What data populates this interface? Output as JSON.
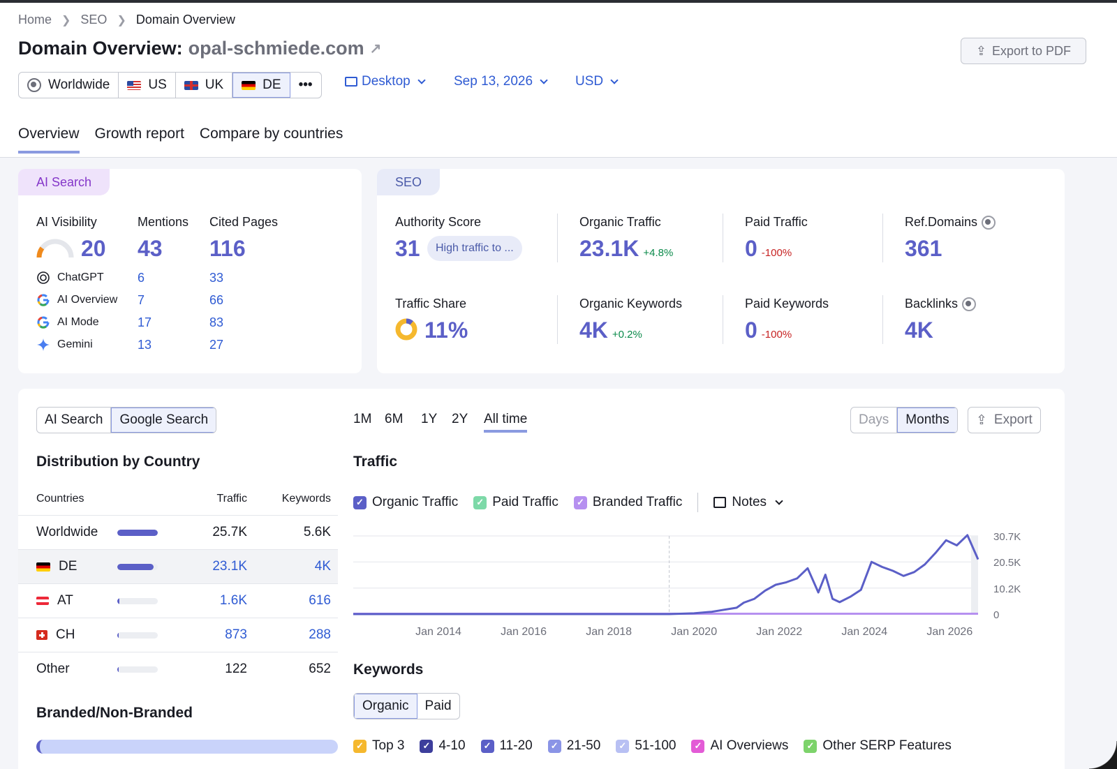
{
  "breadcrumb": [
    "Home",
    "SEO",
    "Domain Overview"
  ],
  "title": {
    "prefix": "Domain Overview:",
    "domain": "opal-schmiede.com"
  },
  "export_pdf_label": "Export to PDF",
  "regions": [
    {
      "label": "Worldwide",
      "flag": "globe-icon"
    },
    {
      "label": "US",
      "flag": "us"
    },
    {
      "label": "UK",
      "flag": "uk"
    },
    {
      "label": "DE",
      "flag": "de",
      "active": true
    }
  ],
  "more_label": "•••",
  "filters": {
    "device": "Desktop",
    "date": "Sep 13, 2026",
    "currency": "USD"
  },
  "tabs": [
    "Overview",
    "Growth report",
    "Compare by countries"
  ],
  "ai_search": {
    "tag": "AI Search",
    "visibility_label": "AI Visibility",
    "visibility_value": "20",
    "visibility_fraction": 0.2,
    "mentions_label": "Mentions",
    "mentions_value": "43",
    "cited_label": "Cited Pages",
    "cited_value": "116",
    "rows": [
      {
        "name": "ChatGPT",
        "mentions": "6",
        "cited": "33",
        "icon": "chatgpt-icon"
      },
      {
        "name": "AI Overview",
        "mentions": "7",
        "cited": "66",
        "icon": "google-icon"
      },
      {
        "name": "AI Mode",
        "mentions": "17",
        "cited": "83",
        "icon": "google-icon"
      },
      {
        "name": "Gemini",
        "mentions": "13",
        "cited": "27",
        "icon": "gemini-icon"
      }
    ]
  },
  "seo": {
    "tag": "SEO",
    "authority_label": "Authority Score",
    "authority_value": "31",
    "authority_pill": "High traffic to ...",
    "organic_traffic_label": "Organic Traffic",
    "organic_traffic_value": "23.1K",
    "organic_traffic_delta": "+4.8%",
    "paid_traffic_label": "Paid Traffic",
    "paid_traffic_value": "0",
    "paid_traffic_delta": "-100%",
    "ref_domains_label": "Ref.Domains",
    "ref_domains_value": "361",
    "traffic_share_label": "Traffic Share",
    "traffic_share_value": "11%",
    "traffic_share_fraction": 0.11,
    "organic_kw_label": "Organic Keywords",
    "organic_kw_value": "4K",
    "organic_kw_delta": "+0.2%",
    "paid_kw_label": "Paid Keywords",
    "paid_kw_value": "0",
    "paid_kw_delta": "-100%",
    "backlinks_label": "Backlinks",
    "backlinks_value": "4K"
  },
  "source_toggle": {
    "options": [
      "AI Search",
      "Google Search"
    ],
    "selected": "Google Search"
  },
  "periods": [
    "1M",
    "6M",
    "1Y",
    "2Y",
    "All time"
  ],
  "period_selected": "All time",
  "granularity": {
    "options": [
      "Days",
      "Months"
    ],
    "selected": "Months"
  },
  "export_label": "Export",
  "distribution": {
    "title": "Distribution by Country",
    "headers": {
      "countries": "Countries",
      "traffic": "Traffic",
      "keywords": "Keywords"
    },
    "rows": [
      {
        "country": "Worldwide",
        "flag": "",
        "traffic": "25.7K",
        "keywords": "5.6K",
        "share": 1.0,
        "link": false
      },
      {
        "country": "DE",
        "flag": "de",
        "traffic": "23.1K",
        "keywords": "4K",
        "share": 0.9,
        "link": true,
        "highlight": true
      },
      {
        "country": "AT",
        "flag": "at",
        "traffic": "1.6K",
        "keywords": "616",
        "share": 0.06,
        "link": true
      },
      {
        "country": "CH",
        "flag": "ch",
        "traffic": "873",
        "keywords": "288",
        "share": 0.03,
        "link": true
      },
      {
        "country": "Other",
        "flag": "",
        "traffic": "122",
        "keywords": "652",
        "share": 0.01,
        "link": false
      }
    ]
  },
  "branded_title": "Branded/Non-Branded",
  "traffic_title": "Traffic",
  "traffic_legend": [
    {
      "label": "Organic Traffic",
      "color": "#5b5fc7"
    },
    {
      "label": "Paid Traffic",
      "color": "#7dd9a8"
    },
    {
      "label": "Branded Traffic",
      "color": "#b690f0"
    }
  ],
  "notes_label": "Notes",
  "keywords_title": "Keywords",
  "keywords_toggle": {
    "options": [
      "Organic",
      "Paid"
    ],
    "selected": "Organic"
  },
  "keywords_legend": [
    {
      "label": "Top 3",
      "color": "#f5b82e"
    },
    {
      "label": "4-10",
      "color": "#3d3e9c"
    },
    {
      "label": "11-20",
      "color": "#5b5fc7"
    },
    {
      "label": "21-50",
      "color": "#8a94e6"
    },
    {
      "label": "51-100",
      "color": "#b8c0f3"
    },
    {
      "label": "AI Overviews",
      "color": "#e35bd6"
    },
    {
      "label": "Other SERP Features",
      "color": "#7dd36b"
    }
  ],
  "chart_data": {
    "type": "line",
    "title": "Traffic",
    "x_ticks": [
      "Jan 2014",
      "Jan 2016",
      "Jan 2018",
      "Jan 2020",
      "Jan 2022",
      "Jan 2024",
      "Jan 2026"
    ],
    "y_ticks": [
      "0",
      "10.2K",
      "20.5K",
      "30.7K"
    ],
    "ylim": [
      0,
      30700
    ],
    "xlim": [
      "2012-01",
      "2026-09"
    ],
    "series": [
      {
        "name": "Organic Traffic",
        "color": "#5b5fc7",
        "x": [
          "2012-01",
          "2019-06",
          "2020-01",
          "2020-06",
          "2021-01",
          "2021-03",
          "2021-06",
          "2021-09",
          "2021-12",
          "2022-03",
          "2022-06",
          "2022-09",
          "2022-12",
          "2023-02",
          "2023-04",
          "2023-06",
          "2023-09",
          "2023-12",
          "2024-03",
          "2024-06",
          "2024-09",
          "2024-12",
          "2025-03",
          "2025-06",
          "2025-09",
          "2025-12",
          "2026-03",
          "2026-06",
          "2026-09"
        ],
        "values": [
          0,
          0,
          300,
          900,
          2500,
          4500,
          6000,
          9200,
          11500,
          12500,
          14000,
          18000,
          8500,
          15500,
          6000,
          4700,
          6800,
          9500,
          20500,
          18500,
          17000,
          15000,
          16500,
          19500,
          24000,
          29000,
          27000,
          31000,
          21500
        ]
      },
      {
        "name": "Branded Traffic",
        "color": "#b690f0",
        "x": [
          "2012-01",
          "2026-09"
        ],
        "values": [
          150,
          150
        ]
      }
    ],
    "grid": true,
    "legend": "top-left"
  }
}
